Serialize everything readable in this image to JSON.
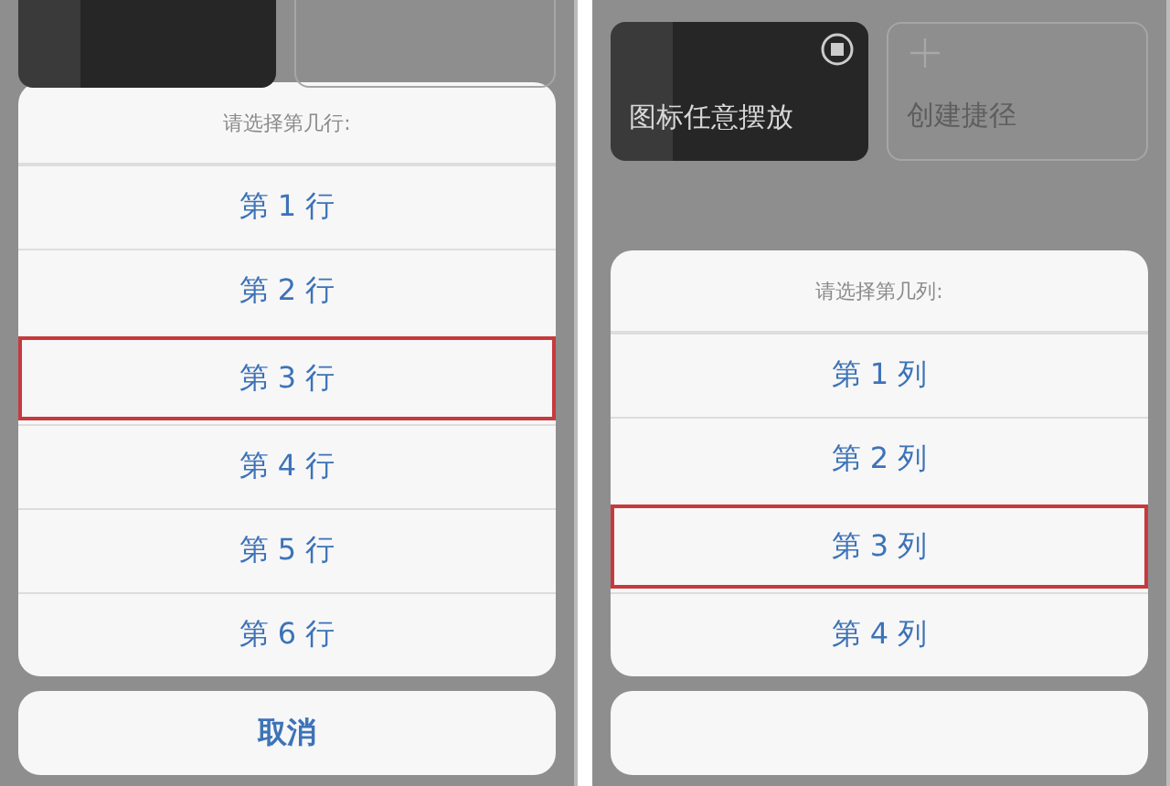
{
  "panels": [
    {
      "cards": [
        {
          "kind": "shortcut"
        },
        {
          "kind": "create"
        }
      ],
      "sheet": {
        "title": "请选择第几行:",
        "options": [
          {
            "label": "第 1 行",
            "selected": false
          },
          {
            "label": "第 2 行",
            "selected": false
          },
          {
            "label": "第 3 行",
            "selected": true
          },
          {
            "label": "第 4 行",
            "selected": false
          },
          {
            "label": "第 5 行",
            "selected": false
          },
          {
            "label": "第 6 行",
            "selected": false
          }
        ],
        "cancel": "取消"
      }
    },
    {
      "cards": [
        {
          "kind": "shortcut",
          "label": "图标任意摆放"
        },
        {
          "kind": "create",
          "label": "创建捷径"
        }
      ],
      "sheet": {
        "title": "请选择第几列:",
        "options": [
          {
            "label": "第 1 列",
            "selected": false
          },
          {
            "label": "第 2 列",
            "selected": false
          },
          {
            "label": "第 3 列",
            "selected": true
          },
          {
            "label": "第 4 列",
            "selected": false
          }
        ]
      }
    }
  ]
}
